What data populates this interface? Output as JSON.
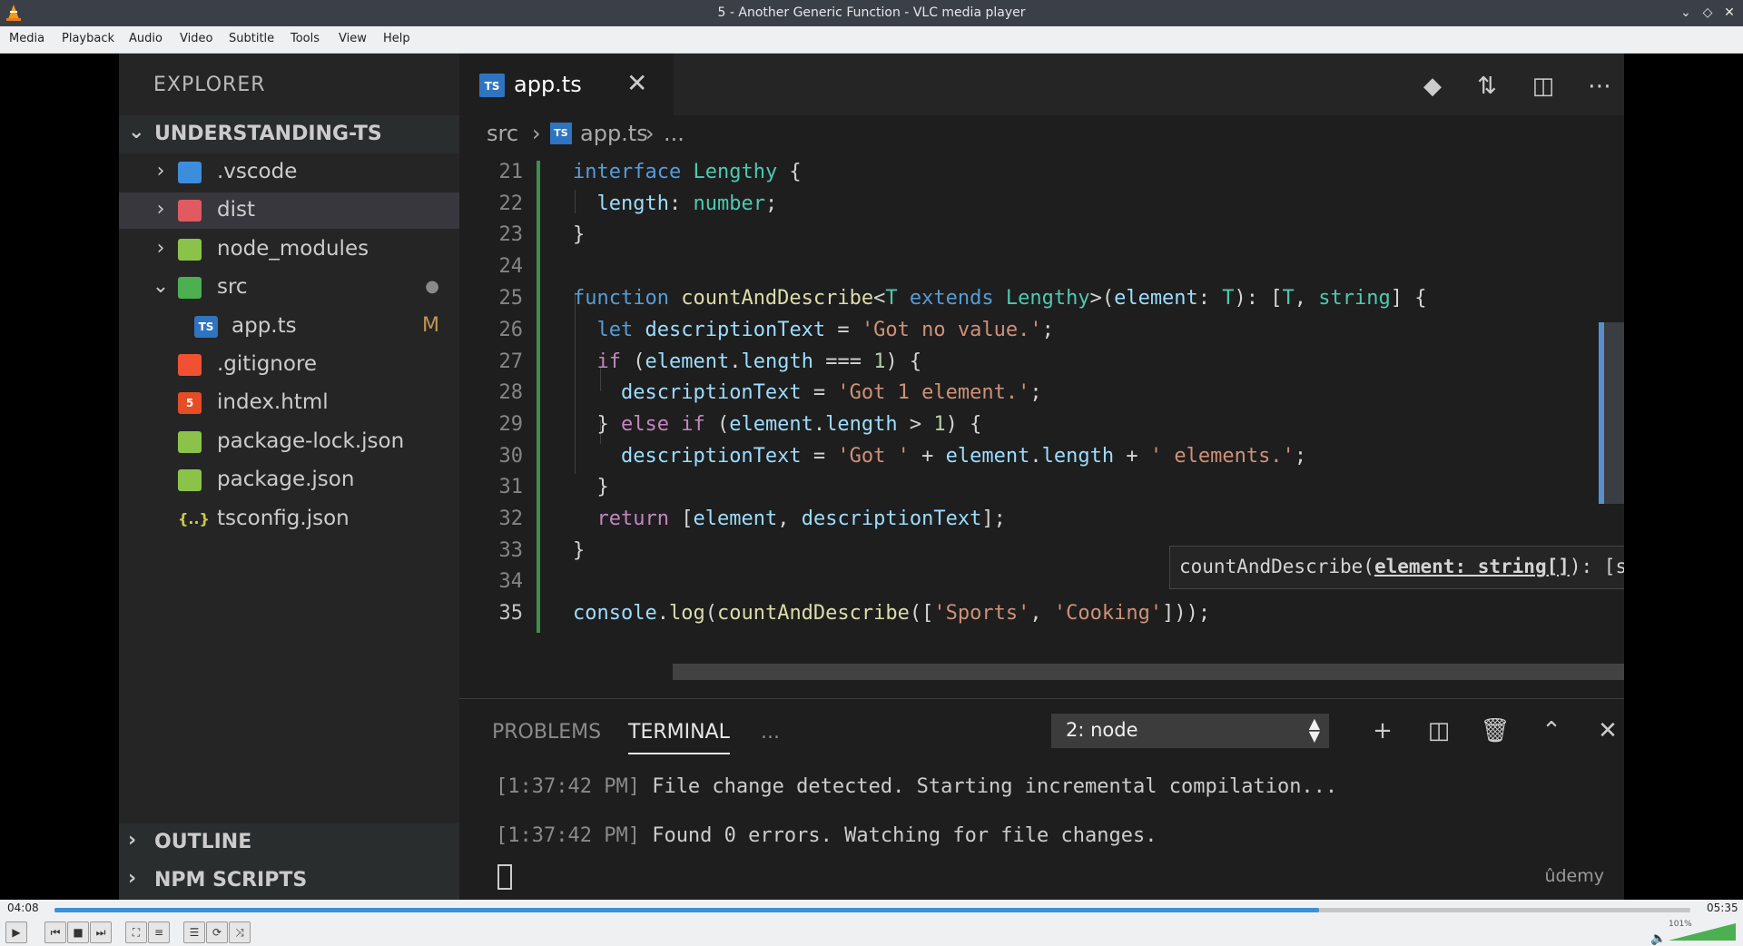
{
  "window": {
    "title": "5 - Another Generic Function - VLC media player"
  },
  "menu": [
    "Media",
    "Playback",
    "Audio",
    "Video",
    "Subtitle",
    "Tools",
    "View",
    "Help"
  ],
  "explorer": {
    "title": "EXPLORER",
    "project": "UNDERSTANDING-TS",
    "items": [
      {
        "label": ".vscode",
        "icon": "vscode-folder-icon",
        "color": "#3c8ddc"
      },
      {
        "label": "dist",
        "icon": "dist-folder-icon",
        "color": "#e05a60"
      },
      {
        "label": "node_modules",
        "icon": "node-modules-folder-icon",
        "color": "#8bc34a"
      },
      {
        "label": "src",
        "icon": "src-folder-icon",
        "color": "#4caf50",
        "badge": "●"
      },
      {
        "label": "app.ts",
        "icon": "typescript-file-icon",
        "color": "#2f74c0",
        "badge": "M"
      },
      {
        "label": ".gitignore",
        "icon": "git-icon",
        "color": "#f05133"
      },
      {
        "label": "index.html",
        "icon": "html5-icon",
        "color": "#e44d26"
      },
      {
        "label": "package-lock.json",
        "icon": "nodejs-icon",
        "color": "#8bc34a"
      },
      {
        "label": "package.json",
        "icon": "nodejs-icon",
        "color": "#8bc34a"
      },
      {
        "label": "tsconfig.json",
        "icon": "json-icon",
        "color": "#cbcb41"
      }
    ],
    "outline": "OUTLINE",
    "npm_scripts": "NPM SCRIPTS"
  },
  "editor": {
    "tab": "app.ts",
    "tab_icon": "TS",
    "breadcrumb": [
      "src",
      "app.ts",
      "..."
    ],
    "line_numbers": [
      "21",
      "22",
      "23",
      "24",
      "25",
      "26",
      "27",
      "28",
      "29",
      "30",
      "31",
      "32",
      "33",
      "34",
      "35"
    ],
    "hover": {
      "prefix": "countAndDescribe(",
      "param": "element: string[]",
      "suffix": "): [string[], string]"
    }
  },
  "panel": {
    "tabs": [
      "PROBLEMS",
      "TERMINAL",
      "..."
    ],
    "terminal_select": "2: node",
    "lines": [
      {
        "time": "[1:37:42 PM]",
        "text": " File change detected. Starting incremental compilation..."
      },
      {
        "time": "[1:37:42 PM]",
        "text": " Found 0 errors. Watching for file changes."
      }
    ],
    "watermark": "ûdemy"
  },
  "player": {
    "elapsed": "04:08",
    "total": "05:35",
    "progress": 0.7731,
    "volume_label": "101%"
  }
}
